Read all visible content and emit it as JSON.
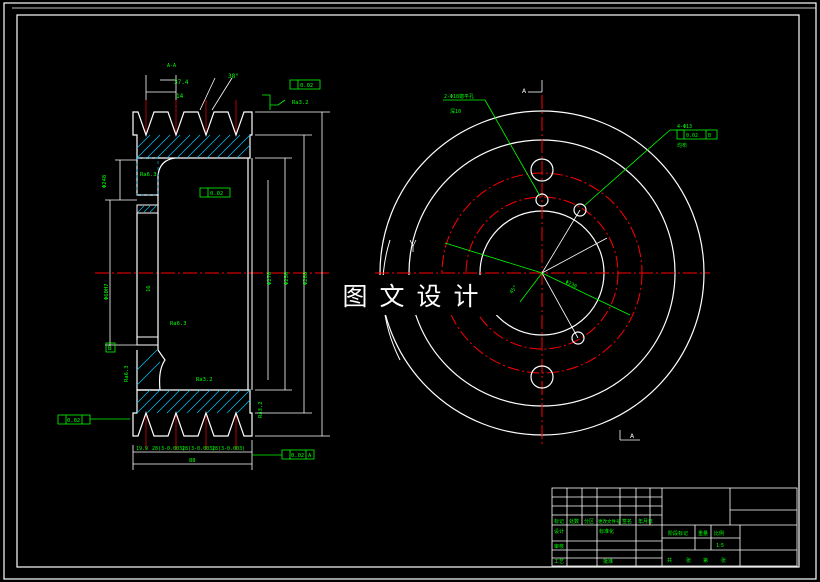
{
  "drawing": {
    "watermark": "图文设计",
    "colors": {
      "background": "#000000",
      "outline": "#ffffff",
      "annotation": "#00ff00",
      "centerline": "#ff0000",
      "leader": "#00ffff",
      "hatch": "#00c8ff"
    },
    "section_view": {
      "labels": {
        "top_a": "A-A",
        "pitch": "37.4",
        "groove_w": "14",
        "angle": "38°",
        "ra_top": "Ra3.2",
        "flatness_top": "0.02",
        "left_dim1": "Φ248",
        "ra_left1": "Ra6.3",
        "tol_mid": "0.02",
        "ra_left2": "Ra6.3",
        "bore": "Φ60H7",
        "center_16": "16",
        "dim_270": "Φ270",
        "dim_250": "Φ250",
        "dim_260": "Φ260",
        "ra_bottom1": "Ra6.3",
        "ra_bottom2": "Ra3.2",
        "ra_right": "Ra3.2",
        "tol_left_bottom": "0.02",
        "dim_b1": "19.9",
        "dim_b2": "28(3-0.003)",
        "dim_b3": "28(3-0.003)",
        "dim_b4": "28(3-0.003)",
        "total_w": "88",
        "tol_bottom": "0.02",
        "datum_b": "B",
        "datum_a": "A"
      }
    },
    "end_view": {
      "labels": {
        "leader_top": "2-Φ18锪平孔",
        "leader_top2": "深10",
        "leader_right": "4-Φ13",
        "tol_right": "0.02",
        "tol_right2": "B",
        "leader_right3": "均布",
        "angle_label": "45°",
        "dia_label": "Φ230",
        "arrow_a_top": "A",
        "arrow_a_bottom": "A"
      }
    },
    "title_block": {
      "cells": {
        "r1": "标记",
        "r2": "处数",
        "r3": "分区",
        "r4": "更改文件号",
        "r5": "签名",
        "r6": "年月日",
        "design": "设计",
        "std": "标准化",
        "check": "审核",
        "process": "工艺",
        "approve": "批准",
        "stage": "阶段标记",
        "weight": "重量",
        "scale": "比例",
        "scale_val": "1:5",
        "sheet1": "共",
        "sheet2": "张",
        "sheet3": "第",
        "sheet4": "张"
      }
    }
  }
}
